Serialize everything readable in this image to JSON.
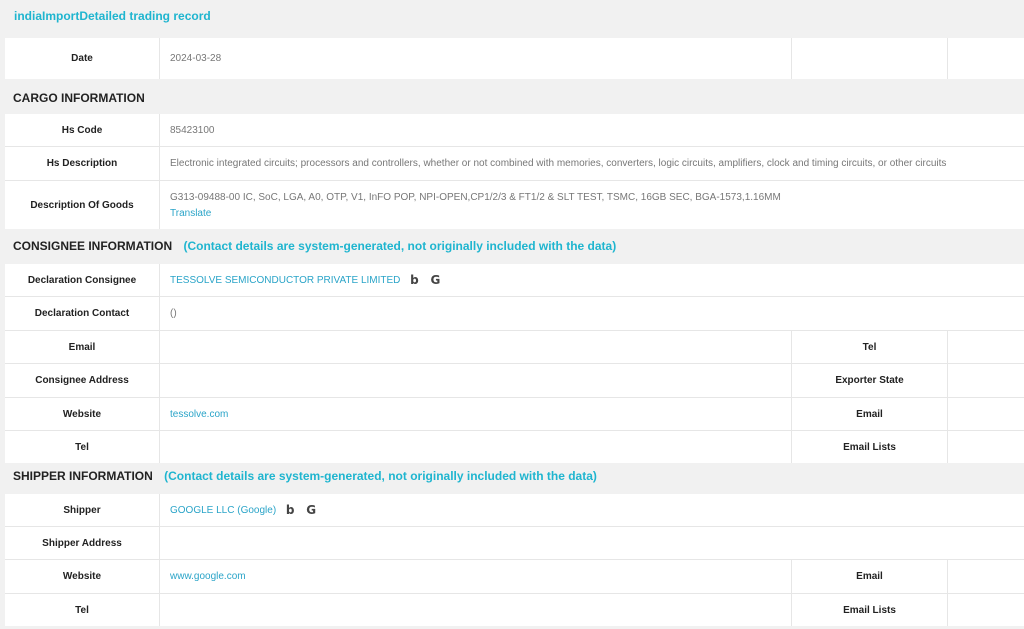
{
  "page": {
    "title": "indiaImportDetailed trading record"
  },
  "date_row": {
    "label": "Date",
    "value": "2024-03-28"
  },
  "cargo": {
    "section_title": "CARGO INFORMATION",
    "hs_code": {
      "label": "Hs Code",
      "value": "85423100"
    },
    "hs_description": {
      "label": "Hs Description",
      "value": "Electronic integrated circuits; processors and controllers, whether or not combined with memories, converters, logic circuits, amplifiers, clock and timing circuits, or other circuits"
    },
    "goods": {
      "label": "Description Of Goods",
      "value": "G313-09488-00 IC, SoC, LGA, A0, OTP, V1, InFO POP, NPI-OPEN,CP1/2/3 & FT1/2 & SLT TEST, TSMC, 16GB SEC, BGA-1573,1.16MM",
      "translate_label": "Translate"
    }
  },
  "consignee": {
    "section_title": "CONSIGNEE INFORMATION",
    "note": "(Contact details are system-generated, not originally included with the data)",
    "declaration_consignee": {
      "label": "Declaration Consignee",
      "value": "TESSOLVE SEMICONDUCTOR PRIVATE LIMITED",
      "icons": [
        "bing-icon",
        "google-icon"
      ]
    },
    "declaration_contact": {
      "label": "Declaration Contact",
      "value": "()"
    },
    "email": {
      "label": "Email",
      "value": "",
      "right_label": "Tel",
      "right_value": ""
    },
    "address": {
      "label": "Consignee Address",
      "value": "",
      "right_label": "Exporter State",
      "right_value": ""
    },
    "website": {
      "label": "Website",
      "value": "tessolve.com",
      "right_label": "Email",
      "right_value": ""
    },
    "tel": {
      "label": "Tel",
      "value": "",
      "right_label": "Email Lists",
      "right_value": ""
    }
  },
  "shipper": {
    "section_title": "SHIPPER INFORMATION",
    "note": "(Contact details are system-generated, not originally included with the data)",
    "shipper": {
      "label": "Shipper",
      "value": "GOOGLE LLC (Google)",
      "icons": [
        "bing-icon",
        "google-icon"
      ]
    },
    "address": {
      "label": "Shipper Address",
      "value": ""
    },
    "website": {
      "label": "Website",
      "value": "www.google.com",
      "right_label": "Email",
      "right_value": ""
    },
    "tel": {
      "label": "Tel",
      "value": "",
      "right_label": "Email Lists",
      "right_value": ""
    }
  },
  "colors": {
    "accent": "#1fb5cf",
    "link": "#2aa4c8",
    "background": "#f1f1f1",
    "label_text": "#222222",
    "value_text": "#777777"
  }
}
